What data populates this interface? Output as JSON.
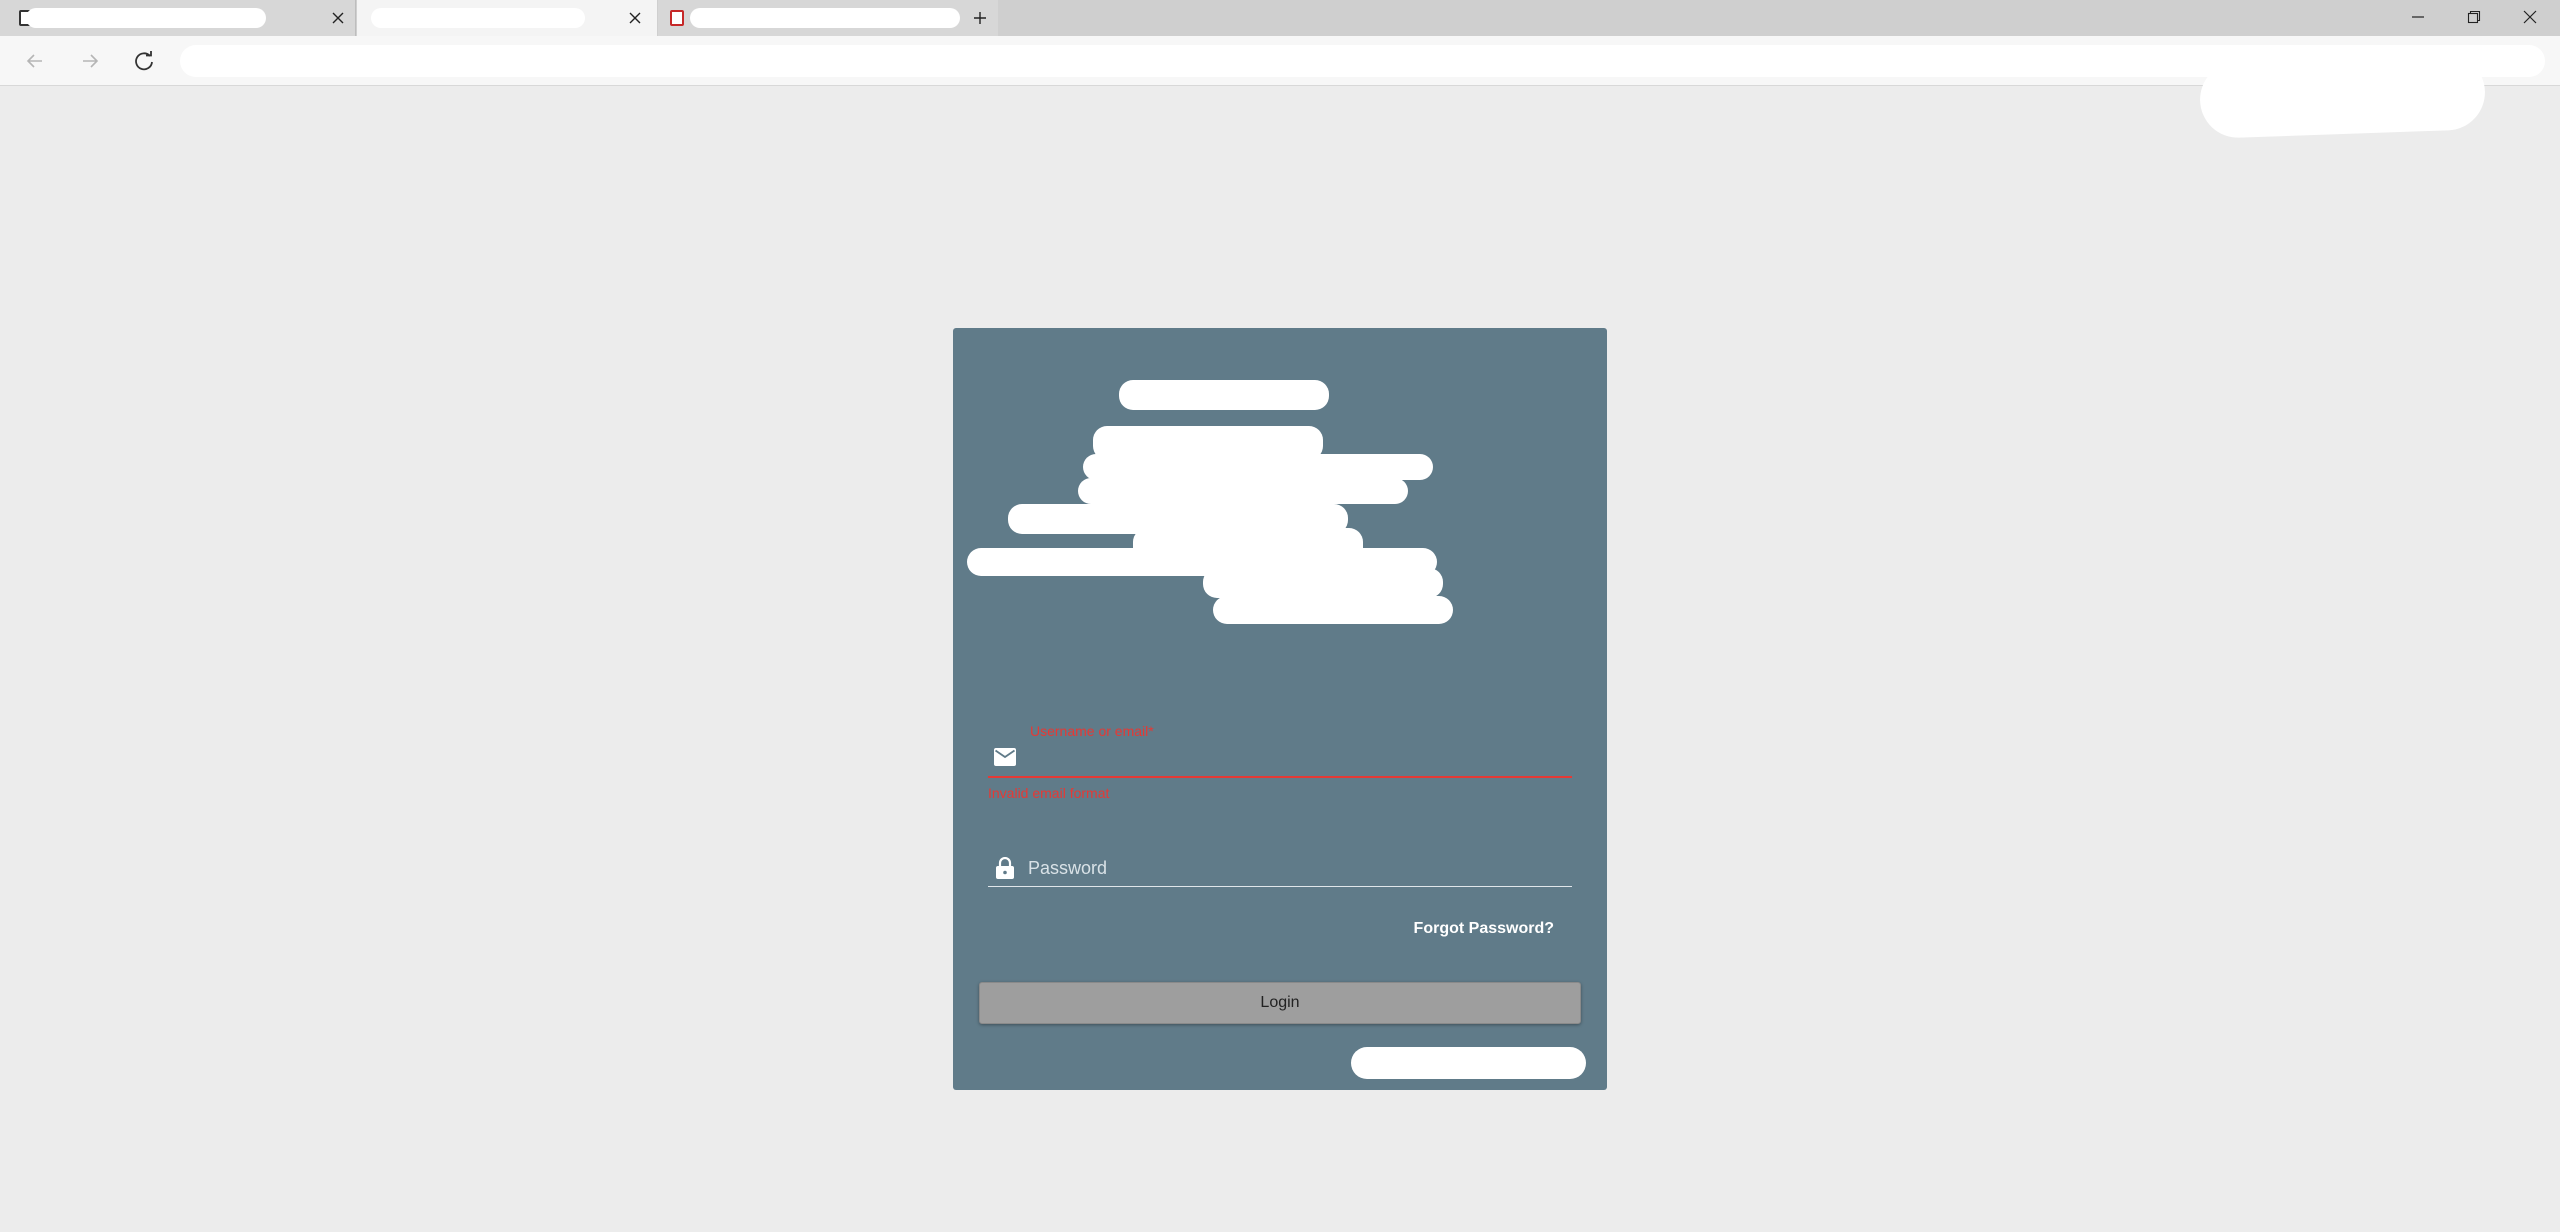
{
  "browser": {
    "tabs": [
      {
        "label": "",
        "close_icon": "close-icon"
      },
      {
        "label": "",
        "close_icon": "close-icon"
      },
      {
        "label": ""
      }
    ],
    "window_controls": [
      "minimize-icon",
      "restore-icon",
      "close-icon"
    ],
    "address_bar": {
      "url": ""
    }
  },
  "login": {
    "email": {
      "label": "Username or email*",
      "value": "",
      "error": "Invalid email format",
      "icon": "mail-icon"
    },
    "password": {
      "placeholder": "Password",
      "icon": "lock-icon"
    },
    "forgot_password": "Forgot Password?",
    "login_button": "Login",
    "colors": {
      "card": "#607b89",
      "error": "#e53935",
      "button": "#9e9e9e",
      "background": "#ececec"
    }
  }
}
